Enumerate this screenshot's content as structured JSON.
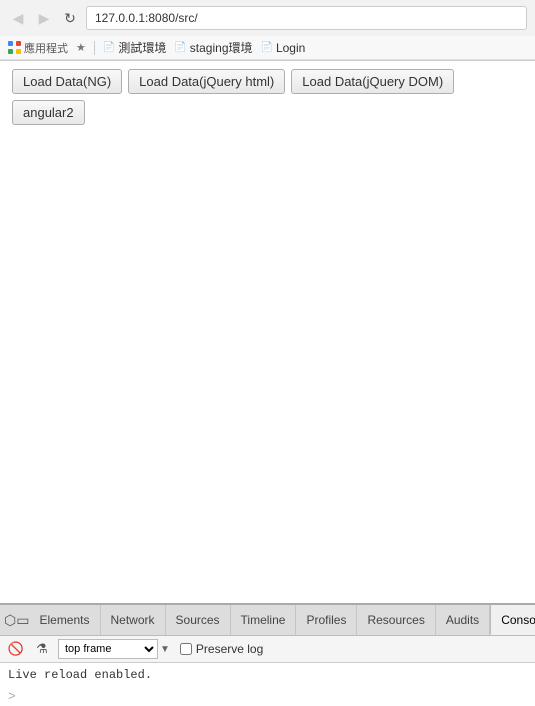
{
  "browser": {
    "address": "127.0.0.1:8080/src/",
    "back_label": "◀",
    "forward_label": "▶",
    "reload_label": "↻"
  },
  "bookmarks": {
    "apps_label": "應用程式",
    "bookmarks_label": "Bookmarks",
    "item1_label": "測試環境",
    "item2_label": "staging環境",
    "item3_label": "Login"
  },
  "page": {
    "btn1_label": "Load Data(NG)",
    "btn2_label": "Load Data(jQuery html)",
    "btn3_label": "Load Data(jQuery DOM)",
    "btn4_label": "angular2"
  },
  "devtools": {
    "tabs": {
      "elements": "Elements",
      "network": "Network",
      "sources": "Sources",
      "timeline": "Timeline",
      "profiles": "Profiles",
      "resources": "Resources",
      "audits": "Audits",
      "console": "Conso..."
    },
    "toolbar": {
      "frame_value": "top frame",
      "preserve_log_label": "Preserve log"
    },
    "console": {
      "line1": "Live reload enabled.",
      "prompt": ">"
    }
  }
}
